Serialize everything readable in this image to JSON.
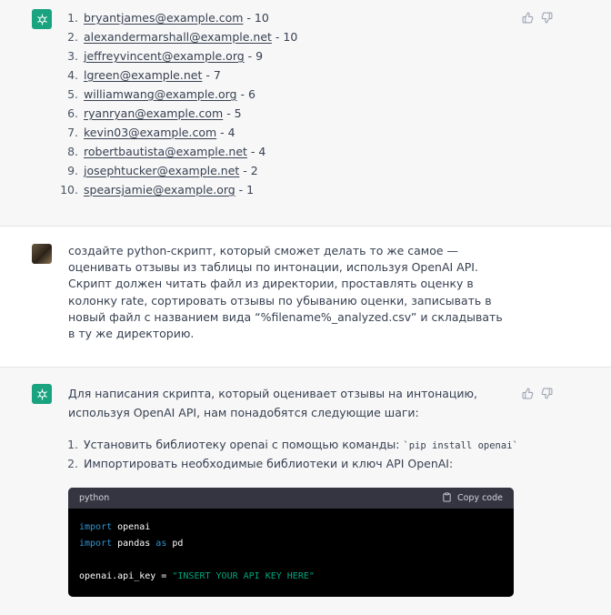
{
  "first_answer": {
    "items": [
      {
        "num": "1.",
        "email": "bryantjames@example.com",
        "count": " - 10"
      },
      {
        "num": "2.",
        "email": "alexandermarshall@example.net",
        "count": " - 10"
      },
      {
        "num": "3.",
        "email": "jeffreyvincent@example.org",
        "count": " - 9"
      },
      {
        "num": "4.",
        "email": "lgreen@example.net",
        "count": " - 7"
      },
      {
        "num": "5.",
        "email": "williamwang@example.org",
        "count": " - 6"
      },
      {
        "num": "6.",
        "email": "ryanryan@example.com",
        "count": " - 5"
      },
      {
        "num": "7.",
        "email": "kevin03@example.com",
        "count": " - 4"
      },
      {
        "num": "8.",
        "email": "robertbautista@example.net",
        "count": " - 4"
      },
      {
        "num": "9.",
        "email": "josephtucker@example.net",
        "count": " - 2"
      },
      {
        "num": "10.",
        "email": "spearsjamie@example.org",
        "count": " - 1"
      }
    ]
  },
  "user_message": {
    "text": "создайте python-скрипт, который сможет делать то же самое — оценивать отзывы из таблицы по интонации, используя OpenAI API. Скрипт должен читать файл из директории, проставлять оценку в колонку rate, сортировать отзывы по убыванию оценки, записывать в новый файл с названием вида “%filename%_analyzed.csv” и складывать в ту же директорию."
  },
  "second_answer": {
    "intro": "Для написания скрипта, который оценивает отзывы на интонацию, используя OpenAI API, нам понадобятся следующие шаги:",
    "steps": [
      {
        "num": "1.",
        "text": "Установить библиотеку openai с помощью команды: ",
        "code": "`pip install openai`"
      },
      {
        "num": "2.",
        "text": "Импортировать необходимые библиотеки и ключ API OpenAI:",
        "code": ""
      }
    ],
    "code_block": {
      "language": "python",
      "copy_label": "Copy code",
      "line1_kw": "import",
      "line1_rest": " openai",
      "line2_kw": "import",
      "line2_mid": " pandas ",
      "line2_kw2": "as",
      "line2_rest": " pd",
      "line4_lhs": "openai.api_key = ",
      "line4_str": "\"INSERT YOUR API KEY HERE\""
    }
  },
  "colors": {
    "gpt_avatar": "#19a37f",
    "code_keyword": "#2e95d3",
    "code_string": "#00a67d"
  },
  "icons": [
    "openai-logo-icon",
    "thumbs-up-icon",
    "thumbs-down-icon",
    "clipboard-icon"
  ]
}
